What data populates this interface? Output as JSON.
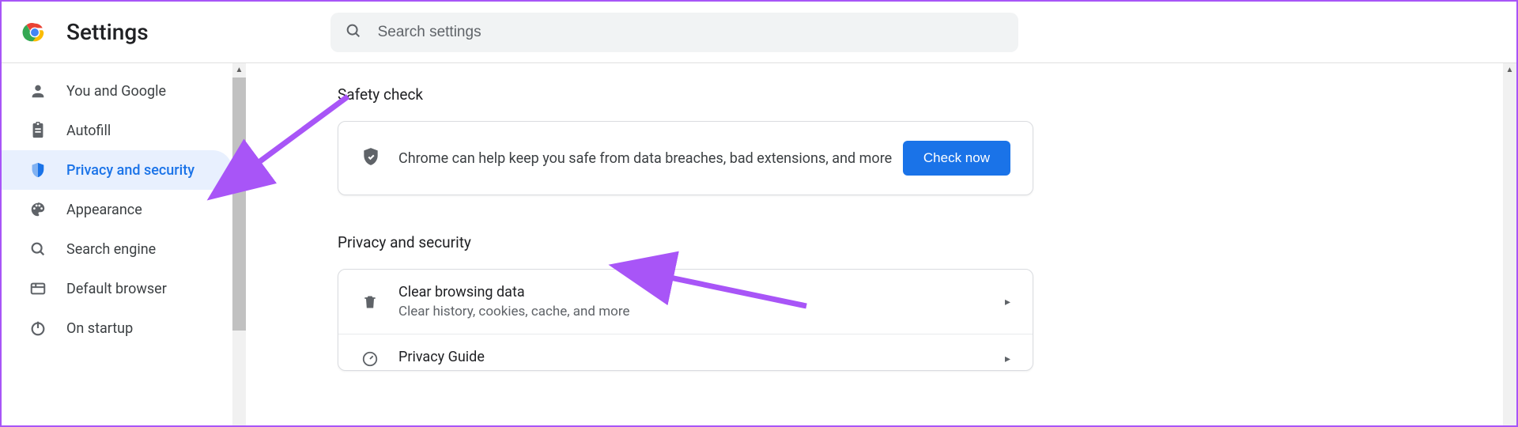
{
  "header": {
    "title": "Settings",
    "search_placeholder": "Search settings"
  },
  "sidebar": {
    "items": [
      {
        "id": "you-and-google",
        "label": "You and Google",
        "icon": "person-icon"
      },
      {
        "id": "autofill",
        "label": "Autofill",
        "icon": "clipboard-icon"
      },
      {
        "id": "privacy-security",
        "label": "Privacy and security",
        "icon": "shield-icon",
        "active": true
      },
      {
        "id": "appearance",
        "label": "Appearance",
        "icon": "palette-icon"
      },
      {
        "id": "search-engine",
        "label": "Search engine",
        "icon": "search-icon"
      },
      {
        "id": "default-browser",
        "label": "Default browser",
        "icon": "browser-icon"
      },
      {
        "id": "on-startup",
        "label": "On startup",
        "icon": "power-icon"
      }
    ]
  },
  "main": {
    "safety_heading": "Safety check",
    "safety_text": "Chrome can help keep you safe from data breaches, bad extensions, and more",
    "check_now_label": "Check now",
    "privacy_heading": "Privacy and security",
    "rows": [
      {
        "title": "Clear browsing data",
        "sub": "Clear history, cookies, cache, and more",
        "icon": "delete-icon"
      },
      {
        "title": "Privacy Guide",
        "sub": "",
        "icon": "gauge-icon"
      }
    ]
  },
  "colors": {
    "accent": "#1a73e8",
    "annotation": "#a855f7"
  }
}
